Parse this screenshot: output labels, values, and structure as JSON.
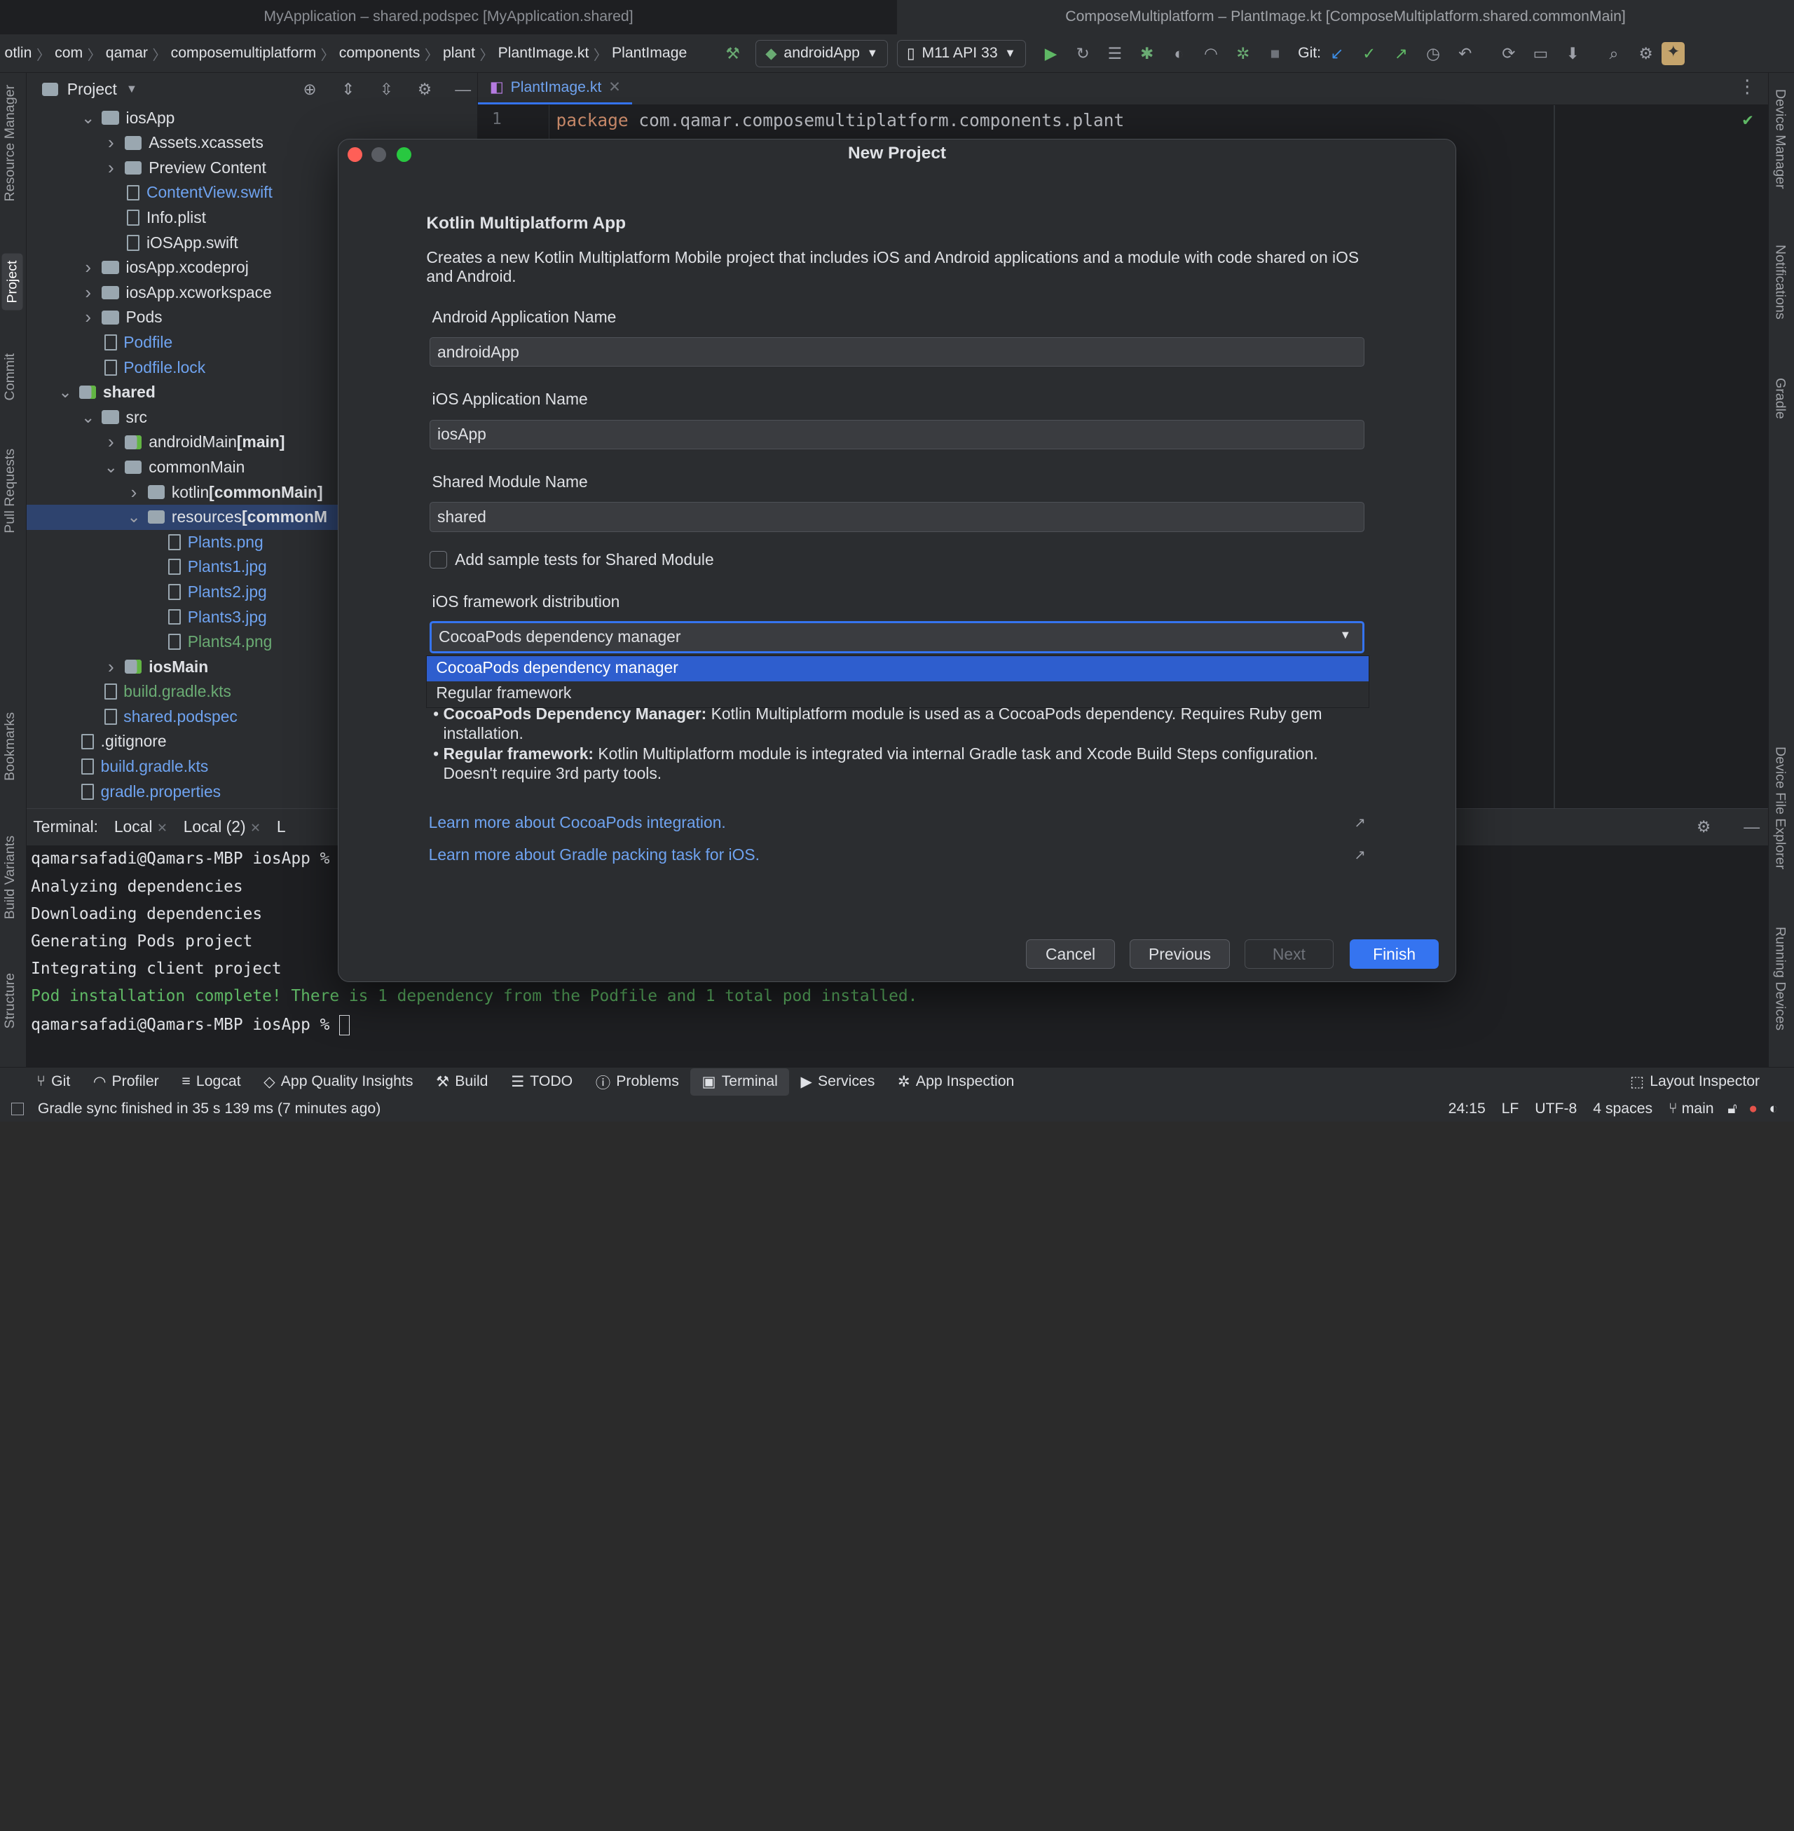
{
  "window": {
    "left_title": "MyApplication – shared.podspec [MyApplication.shared]",
    "right_title": "ComposeMultiplatform – PlantImage.kt [ComposeMultiplatform.shared.commonMain]"
  },
  "navbar": {
    "crumbs": [
      "otlin",
      "com",
      "qamar",
      "composemultiplatform",
      "components",
      "plant",
      "PlantImage.kt",
      "PlantImage"
    ],
    "run_config": "androidApp",
    "device": "M11 API 33",
    "git_label": "Git:"
  },
  "left_stripe": {
    "tabs": [
      "Resource Manager",
      "Project",
      "Commit",
      "Pull Requests",
      "Bookmarks",
      "Build Variants",
      "Structure"
    ]
  },
  "right_stripe": {
    "tabs": [
      "Device Manager",
      "Notifications",
      "Gradle",
      "Device File Explorer",
      "Running Devices"
    ]
  },
  "project": {
    "title": "Project",
    "rows": [
      {
        "label": "iosApp",
        "kind": "folder",
        "expanded": true,
        "color": "white"
      },
      {
        "label": "Assets.xcassets",
        "kind": "folder",
        "expanded": false,
        "color": "white"
      },
      {
        "label": "Preview Content",
        "kind": "folder",
        "expanded": false,
        "color": "white"
      },
      {
        "label": "ContentView.swift",
        "kind": "file",
        "color": "blue"
      },
      {
        "label": "Info.plist",
        "kind": "file",
        "color": "white"
      },
      {
        "label": "iOSApp.swift",
        "kind": "file",
        "color": "white"
      },
      {
        "label": "iosApp.xcodeproj",
        "kind": "folder",
        "expanded": false,
        "color": "white"
      },
      {
        "label": "iosApp.xcworkspace",
        "kind": "folder",
        "expanded": false,
        "color": "white"
      },
      {
        "label": "Pods",
        "kind": "folder",
        "expanded": false,
        "color": "white"
      },
      {
        "label": "Podfile",
        "kind": "file",
        "color": "blue"
      },
      {
        "label": "Podfile.lock",
        "kind": "file",
        "color": "blue"
      },
      {
        "label": "shared",
        "kind": "module",
        "expanded": true,
        "color": "white",
        "bold": true
      },
      {
        "label": "src",
        "kind": "folder",
        "expanded": true,
        "color": "white"
      },
      {
        "label": "androidMain",
        "suffix": " [main]",
        "kind": "module",
        "expanded": false,
        "color": "white"
      },
      {
        "label": "commonMain",
        "kind": "folder",
        "expanded": true,
        "color": "white"
      },
      {
        "label": "kotlin",
        "suffix": " [commonMain]",
        "kind": "folder",
        "expanded": false,
        "color": "white"
      },
      {
        "label": "resources",
        "suffix": " [commonM",
        "kind": "folder",
        "expanded": true,
        "color": "white",
        "selected": true
      },
      {
        "label": "Plants.png",
        "kind": "file",
        "color": "blue"
      },
      {
        "label": "Plants1.jpg",
        "kind": "file",
        "color": "blue"
      },
      {
        "label": "Plants2.jpg",
        "kind": "file",
        "color": "blue"
      },
      {
        "label": "Plants3.jpg",
        "kind": "file",
        "color": "blue"
      },
      {
        "label": "Plants4.png",
        "kind": "file",
        "color": "green"
      },
      {
        "label": "iosMain",
        "kind": "module",
        "expanded": false,
        "color": "white",
        "bold": true
      },
      {
        "label": "build.gradle.kts",
        "kind": "file",
        "color": "green"
      },
      {
        "label": "shared.podspec",
        "kind": "file",
        "color": "blue"
      },
      {
        "label": ".gitignore",
        "kind": "file",
        "color": "white"
      },
      {
        "label": "build.gradle.kts",
        "kind": "file",
        "color": "blue"
      },
      {
        "label": "gradle.properties",
        "kind": "file",
        "color": "blue"
      }
    ]
  },
  "editor": {
    "tab": "PlantImage.kt",
    "line_number": "1",
    "keyword": "package",
    "code": " com.qamar.composemultiplatform.components.plant"
  },
  "terminal": {
    "title": "Terminal:",
    "tabs": [
      "Local",
      "Local (2)",
      "L"
    ],
    "lines": [
      "qamarsafadi@Qamars-MBP iosApp %",
      "Analyzing dependencies",
      "Downloading dependencies",
      "Generating Pods project",
      "Integrating client project",
      "Pod installation complete! There is 1 dependency from the Podfile and 1 total pod installed.",
      "qamarsafadi@Qamars-MBP iosApp %"
    ]
  },
  "bottom_tools": [
    "Git",
    "Profiler",
    "Logcat",
    "App Quality Insights",
    "Build",
    "TODO",
    "Problems",
    "Terminal",
    "Services",
    "App Inspection"
  ],
  "layout_inspector": "Layout Inspector",
  "status": {
    "message": "Gradle sync finished in 35 s 139 ms (7 minutes ago)",
    "position": "24:15",
    "line_sep": "LF",
    "encoding": "UTF-8",
    "indent": "4 spaces",
    "branch": "main"
  },
  "dialog": {
    "title": "New Project",
    "heading": "Kotlin Multiplatform App",
    "description": "Creates a new Kotlin Multiplatform Mobile project that includes iOS and Android applications and a module with code shared on iOS and Android.",
    "android_name_label": "Android Application Name",
    "android_name_value": "androidApp",
    "ios_name_label": "iOS Application Name",
    "ios_name_value": "iosApp",
    "shared_label": "Shared Module Name",
    "shared_value": "shared",
    "tests_label": "Add sample tests for Shared Module",
    "dist_label": "iOS framework distribution",
    "dist_value": "CocoaPods dependency manager",
    "options": [
      "CocoaPods dependency manager",
      "Regular framework"
    ],
    "bullet1_bold": "CocoaPods Dependency Manager:",
    "bullet1_text": " Kotlin Multiplatform module is used as a CocoaPods dependency. Requires Ruby gem installation.",
    "bullet2_bold": "Regular framework:",
    "bullet2_text": " Kotlin Multiplatform module is integrated via internal Gradle task and Xcode Build Steps configuration. Doesn't require 3rd party tools.",
    "link1": "Learn more about CocoaPods integration.",
    "link2": "Learn more about Gradle packing task for iOS.",
    "cancel": "Cancel",
    "previous": "Previous",
    "next": "Next",
    "finish": "Finish"
  },
  "colors": {
    "accent": "#3574f0",
    "link": "#6fa3f0",
    "green": "#6aab73",
    "close": "#ff5f57",
    "min": "#5a5d63",
    "max": "#28c840"
  }
}
